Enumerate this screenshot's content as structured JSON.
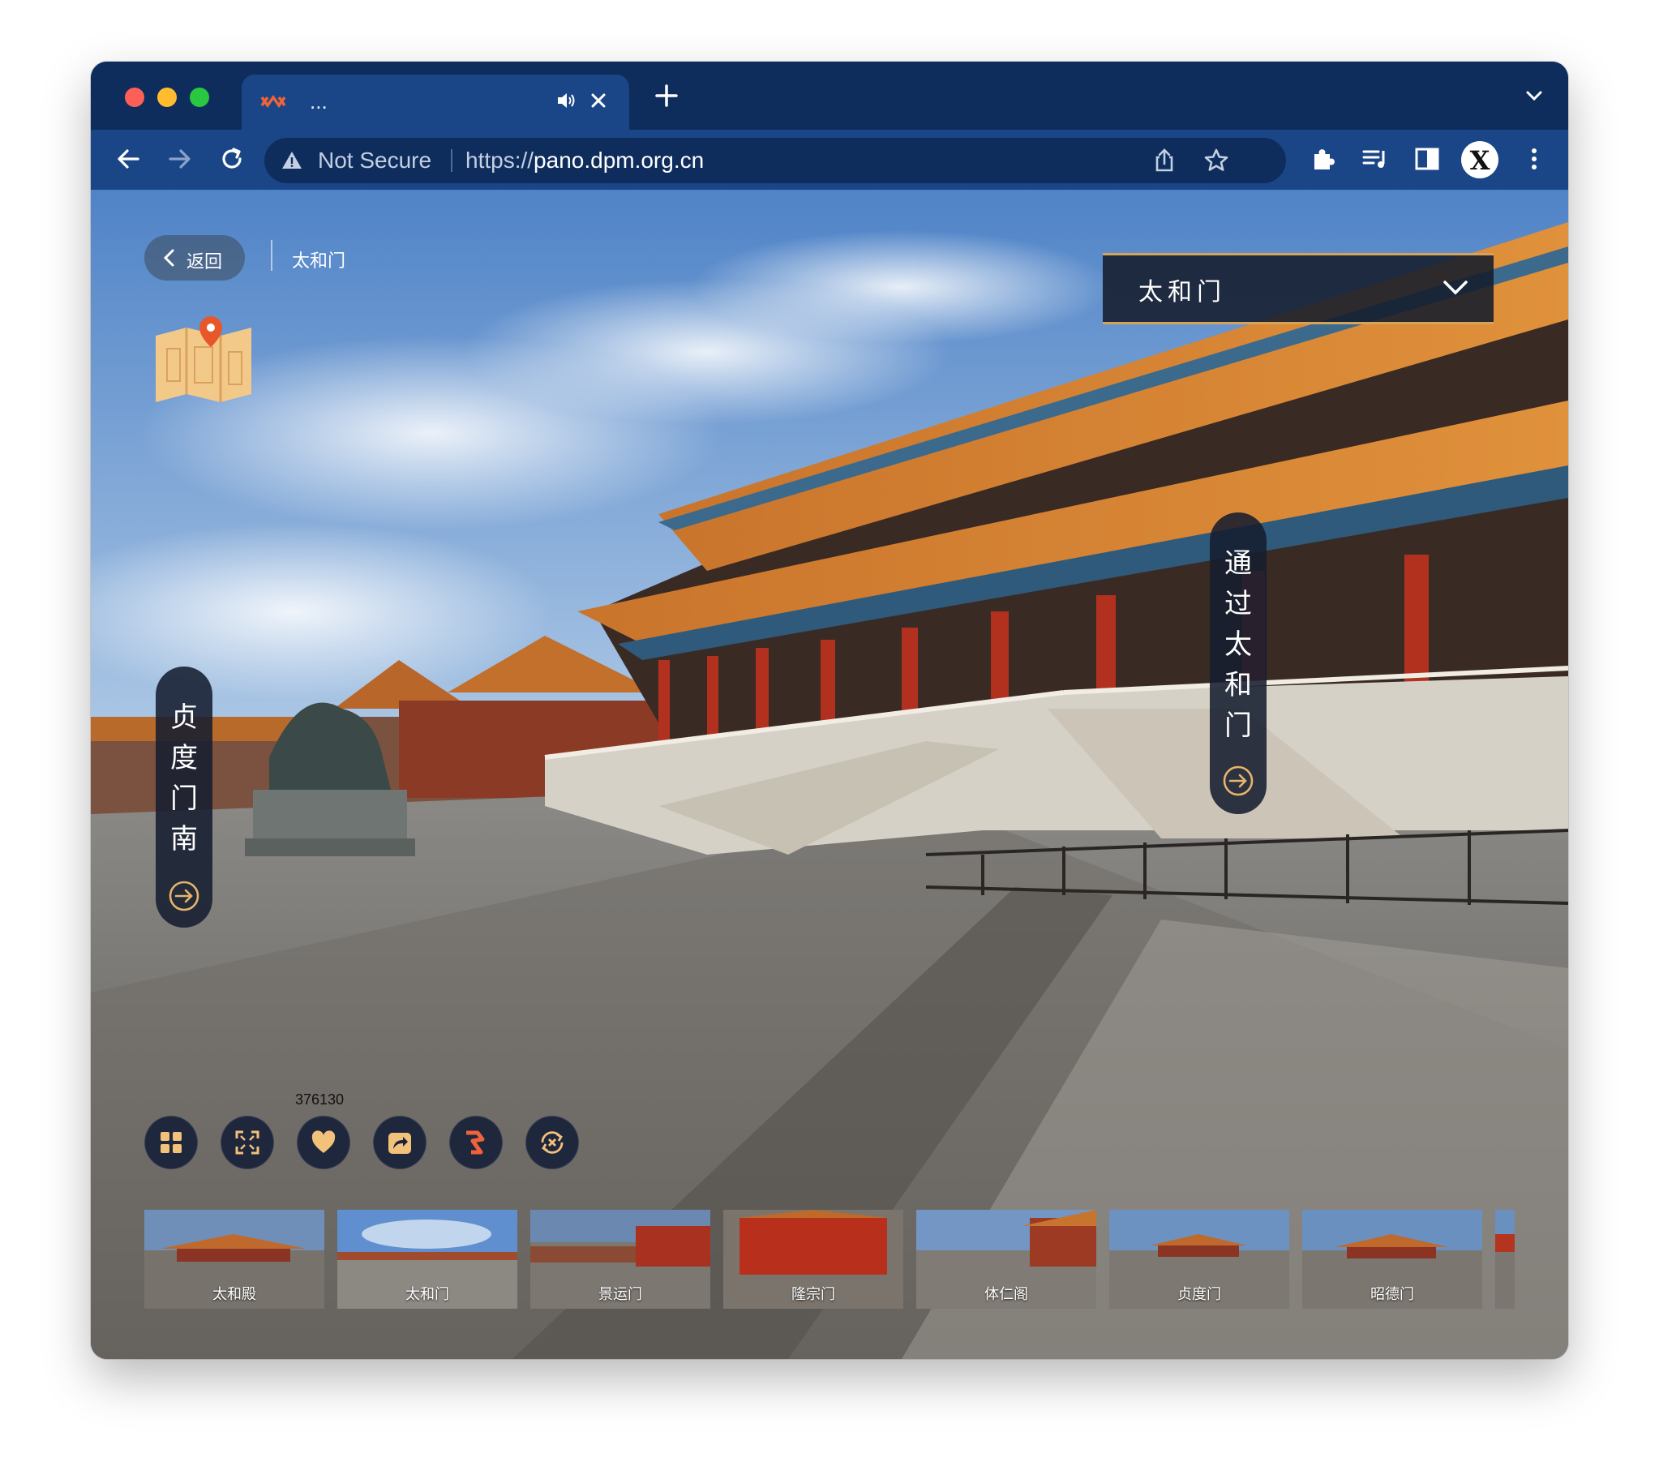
{
  "browser": {
    "tab_title": "...",
    "security_label": "Not Secure",
    "url_scheme": "https://",
    "url_host": "pano.dpm.org.cn",
    "profile_letter": "X"
  },
  "page": {
    "back_label": "返回",
    "breadcrumb": "太和门",
    "scene_select": "太和门",
    "hotspot_left": "贞度门南",
    "hotspot_right": "通过太和门",
    "like_count": "376130"
  },
  "controls": [
    "grid",
    "fullscreen",
    "like",
    "share",
    "guide",
    "auto-rotate"
  ],
  "thumbnails": [
    {
      "label": "太和殿",
      "active": false
    },
    {
      "label": "太和门",
      "active": true
    },
    {
      "label": "景运门",
      "active": false
    },
    {
      "label": "隆宗门",
      "active": false
    },
    {
      "label": "体仁阁",
      "active": false
    },
    {
      "label": "贞度门",
      "active": false
    },
    {
      "label": "昭德门",
      "active": false
    }
  ],
  "colors": {
    "tabstrip": "#0f2d5c",
    "toolbar": "#1a4687",
    "accent_gold": "#d5a45a",
    "hotspot_bg": "#161e30",
    "map_pin": "#e8572a"
  }
}
